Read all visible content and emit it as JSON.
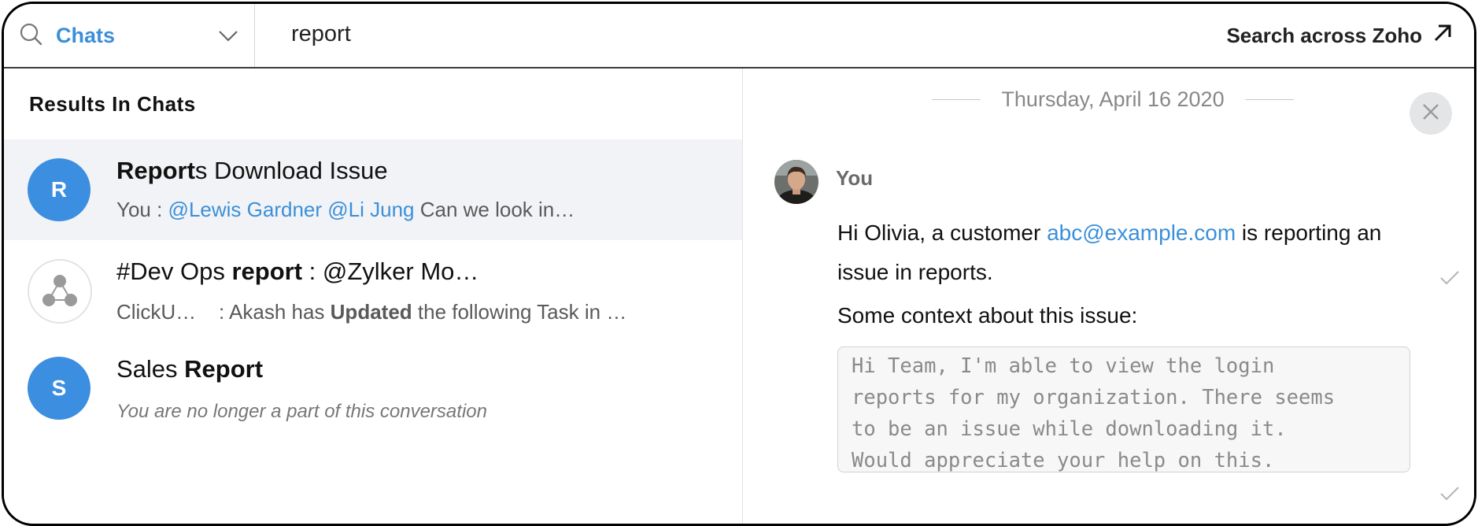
{
  "search": {
    "scope_label": "Chats",
    "query": "report",
    "across_label": "Search across Zoho"
  },
  "results": {
    "heading": "Results In Chats",
    "items": [
      {
        "avatar_letter": "R",
        "title_bold": "Report",
        "title_rest": "s Download Issue",
        "sub_prefix": "You : ",
        "sub_mention1": "@Lewis Gardner",
        "sub_mention2": "@Li Jung",
        "sub_rest": " Can we look in…"
      },
      {
        "avatar_icon": "group-icon",
        "title_pre": "#Dev Ops ",
        "title_bold": "report",
        "title_rest": " : @Zylker Mo…",
        "sub_prefix": "ClickU…    : Akash has ",
        "sub_bold": "Updated",
        "sub_rest": " the following Task in …"
      },
      {
        "avatar_letter": "S",
        "title_pre": "Sales ",
        "title_bold": "Report",
        "sub_italic": "You are no longer a part of this conversation"
      }
    ]
  },
  "preview": {
    "date": "Thursday, April 16 2020",
    "sender": "You",
    "msg_pre": "Hi Olivia, a customer ",
    "msg_link": "abc@example.com",
    "msg_post": " is reporting an issue in reports.",
    "context_label": "Some context about this issue:",
    "quote_text": "Hi Team, I'm able to view the login\nreports for my organization. There seems\nto be an issue while downloading it.\nWould appreciate your help on this."
  },
  "colors": {
    "accent": "#3b8fd9",
    "avatar_blue": "#3b8ee0",
    "selected_row": "#f2f3f6"
  }
}
